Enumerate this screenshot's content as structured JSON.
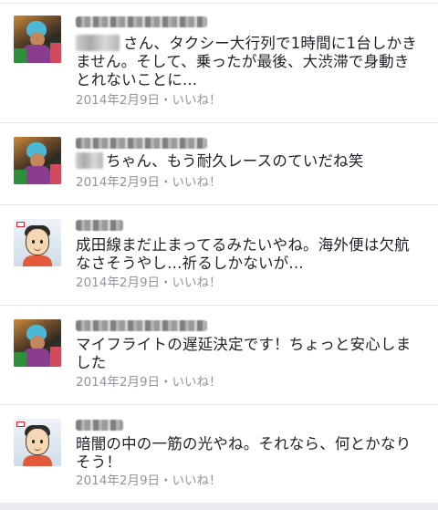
{
  "comments": [
    {
      "avatar": "profile-photo",
      "name_redacted": true,
      "text": "さん、タクシー大行列で1時間に1台しかき\nません。そして、乗ったが最後、大渋滞で身動き\nとれないことに...",
      "date": "2014年2月9日",
      "separator": "・",
      "like": "いいね！"
    },
    {
      "avatar": "profile-photo",
      "name_redacted": true,
      "text": "ちゃん、もう耐久レースのていだね笑",
      "date": "2014年2月9日",
      "separator": "・",
      "like": "いいね！"
    },
    {
      "avatar": "cartoon-avatar",
      "name_redacted": true,
      "text": "成田線まだ止まってるみたいやね。海外便は欠航\nなさそうやし...祈るしかないが...",
      "date": "2014年2月9日",
      "separator": "・",
      "like": "いいね！"
    },
    {
      "avatar": "profile-photo",
      "name_redacted": true,
      "text": "マイフライトの遅延決定です！ちょっと安心しま\nした",
      "date": "2014年2月9日",
      "separator": "・",
      "like": "いいね！"
    },
    {
      "avatar": "cartoon-avatar",
      "name_redacted": true,
      "text": "暗闇の中の一筋の光やね。それなら、何とかなり\nそう！",
      "date": "2014年2月9日",
      "separator": "・",
      "like": "いいね！"
    }
  ],
  "colors": {
    "text": "#1d2129",
    "meta": "#90949c",
    "divider": "#e1e3e8"
  }
}
